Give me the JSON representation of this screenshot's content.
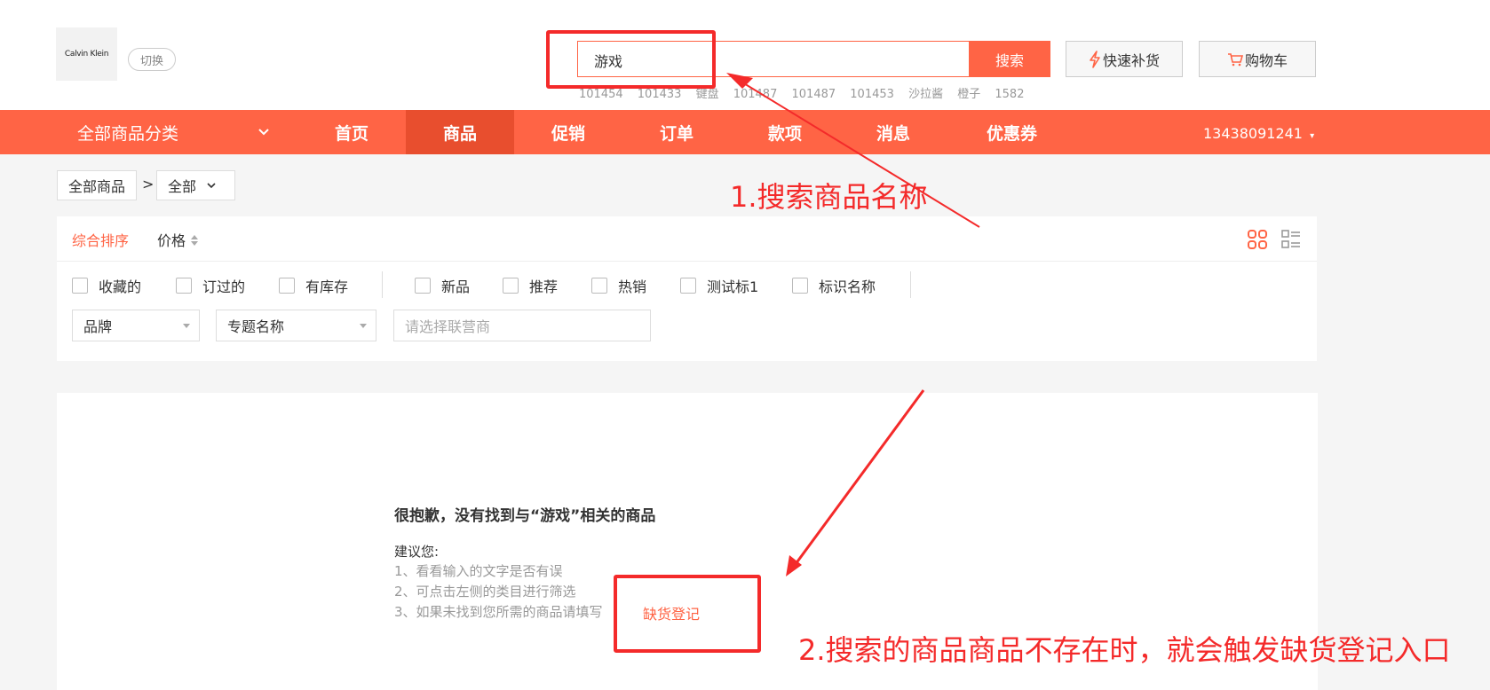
{
  "header": {
    "logo_text": "Calvin Klein",
    "switch_label": "切换",
    "search": {
      "value": "游戏",
      "button_label": "搜索"
    },
    "hot_words": [
      "101454",
      "101433",
      "键盘",
      "101487",
      "101487",
      "101453",
      "沙拉酱",
      "橙子",
      "1582"
    ],
    "quick_restock_label": "快速补货",
    "cart_label": "购物车"
  },
  "nav": {
    "category_label": "全部商品分类",
    "items": [
      {
        "label": "首页"
      },
      {
        "label": "商品"
      },
      {
        "label": "促销"
      },
      {
        "label": "订单"
      },
      {
        "label": "款项"
      },
      {
        "label": "消息"
      },
      {
        "label": "优惠券"
      }
    ],
    "active_item": "商品",
    "user": "13438091241"
  },
  "breadcrumb": {
    "root": "全部商品",
    "separator": ">",
    "current": "全部"
  },
  "filters": {
    "sort": {
      "comprehensive": "综合排序",
      "price": "价格"
    },
    "checkboxes": [
      "收藏的",
      "订过的",
      "有库存",
      "新品",
      "推荐",
      "热销",
      "测试标1",
      "标识名称"
    ],
    "brand_select": "品牌",
    "topic_select": "专题名称",
    "partner_placeholder": "请选择联营商"
  },
  "empty_result": {
    "title": "很抱歉，没有找到与“游戏”相关的商品",
    "suggest_label": "建议您:",
    "tips": [
      "1、看看输入的文字是否有误",
      "2、可点击左侧的类目进行筛选",
      "3、如果未找到您所需的商品请填写"
    ],
    "register_link": "缺货登记"
  },
  "annotations": {
    "step1": "1.搜索商品名称",
    "step2": "2.搜索的商品商品不存在时，就会触发缺货登记入口"
  },
  "colors": {
    "accent": "#ff6445",
    "annotation": "#f42a2a"
  }
}
